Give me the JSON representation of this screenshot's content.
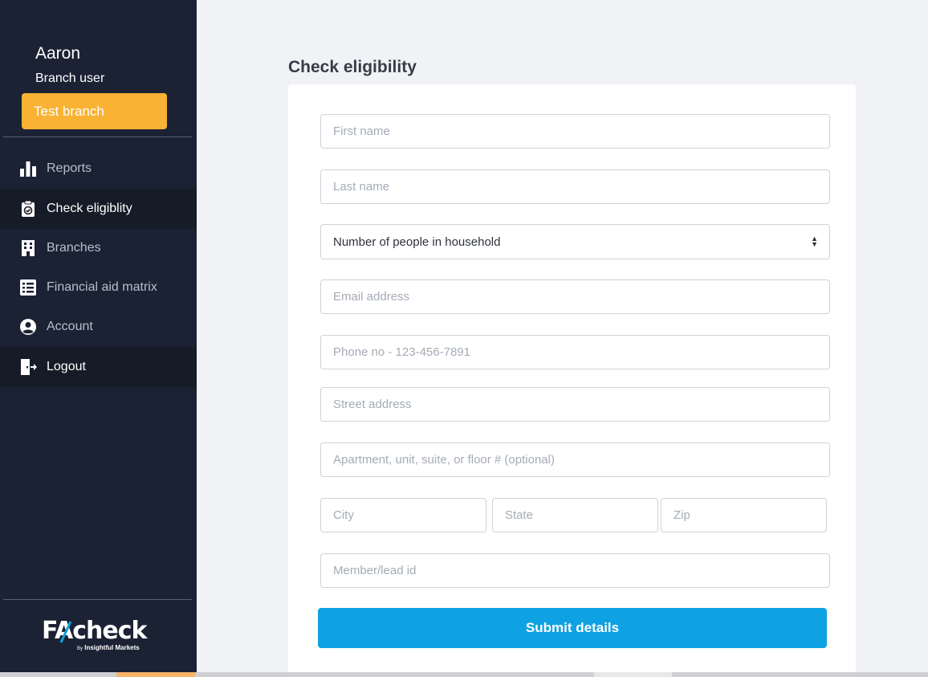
{
  "user": {
    "name": "Aaron",
    "role": "Branch user",
    "branch": "Test branch"
  },
  "nav": [
    {
      "label": "Reports",
      "icon": "bar-chart-icon",
      "active": false
    },
    {
      "label": "Check eligiblity",
      "icon": "clipboard-check-icon",
      "active": true
    },
    {
      "label": "Branches",
      "icon": "building-icon",
      "active": false
    },
    {
      "label": "Financial aid matrix",
      "icon": "list-icon",
      "active": false
    },
    {
      "label": "Account",
      "icon": "user-circle-icon",
      "active": false
    },
    {
      "label": "Logout",
      "icon": "logout-icon",
      "active": false
    }
  ],
  "logo": {
    "main": "FAcheck",
    "by": "By",
    "sub": "Insightful Markets"
  },
  "page": {
    "title": "Check eligibility"
  },
  "form": {
    "first_name": "First name",
    "last_name": "Last name",
    "household": "Number of people in household",
    "email": "Email address",
    "phone": "Phone no - 123-456-7891",
    "street": "Street address",
    "apartment": "Apartment, unit, suite, or floor # (optional)",
    "city": "City",
    "state": "State",
    "zip": "Zip",
    "member_id": "Member/lead id",
    "submit": "Submit details"
  },
  "colors": {
    "sidebar": "#1b2234",
    "branch_badge": "#f9b233",
    "submit": "#0ea2e3"
  }
}
